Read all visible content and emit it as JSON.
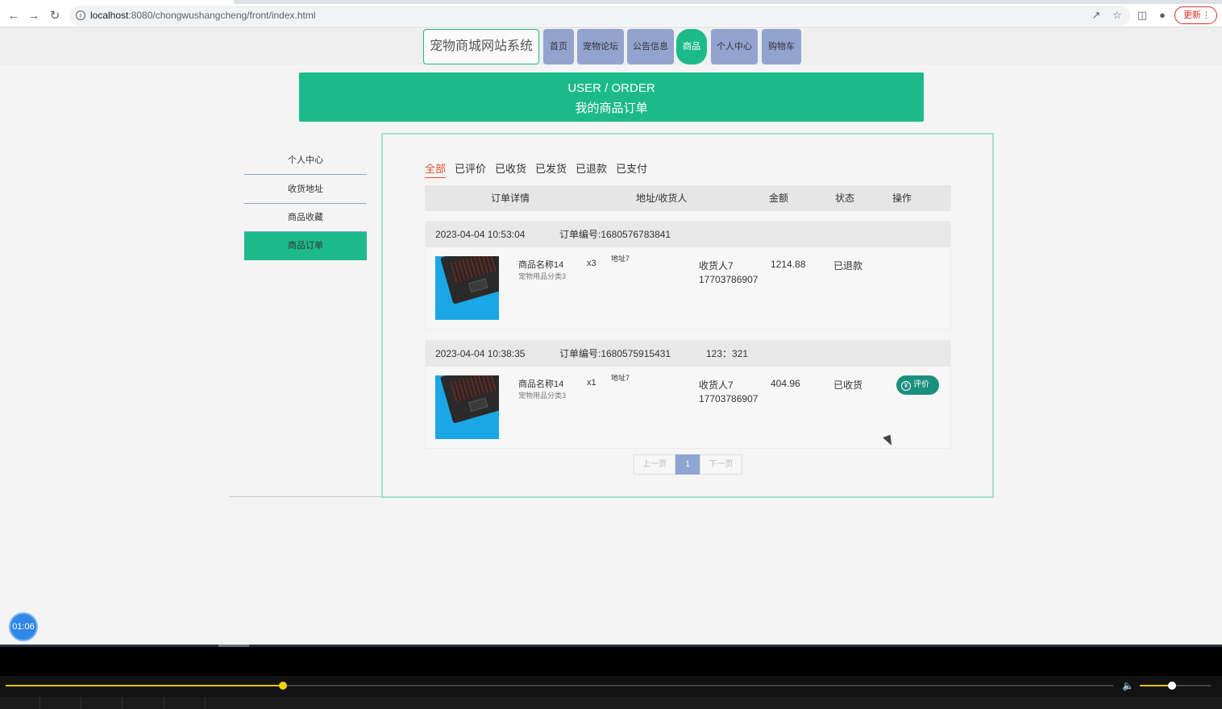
{
  "browser": {
    "url_host": "localhost",
    "url_path": ":8080/chongwushangcheng/front/index.html",
    "update_label": "更新",
    "info_icon": "info-icon",
    "icons": [
      "back-icon",
      "forward-icon",
      "reload-icon",
      "share-icon",
      "star-icon",
      "sidebar-icon",
      "profile-icon"
    ]
  },
  "header": {
    "logo": "宠物商城网站系统",
    "nav": [
      {
        "label": "首页"
      },
      {
        "label": "宠物论坛"
      },
      {
        "label": "公告信息"
      },
      {
        "label": "商品"
      },
      {
        "label": "个人中心"
      },
      {
        "label": "购物车"
      }
    ],
    "active_nav": "商品",
    "accent_color": "#1cba8a",
    "nav_color": "#93a3cf"
  },
  "banner": {
    "en": "USER / ORDER",
    "cn": "我的商品订单"
  },
  "sidebar": {
    "items": [
      {
        "label": "个人中心"
      },
      {
        "label": "收货地址"
      },
      {
        "label": "商品收藏"
      },
      {
        "label": "商品订单"
      }
    ],
    "active": "商品订单"
  },
  "orders": {
    "tabs": [
      {
        "label": "全部"
      },
      {
        "label": "已评价"
      },
      {
        "label": "已收货"
      },
      {
        "label": "已发货"
      },
      {
        "label": "已退款"
      },
      {
        "label": "已支付"
      }
    ],
    "active_tab": "全部",
    "columns": {
      "detail": "订单详情",
      "address": "地址/收货人",
      "amount": "金额",
      "status": "状态",
      "action": "操作"
    },
    "list": [
      {
        "time": "2023-04-04 10:53:04",
        "order_no": "订单编号:1680576783841",
        "note": "",
        "product_name": "商品名称14",
        "product_category": "宠物用品分类3",
        "qty": "x3",
        "address": "地址7",
        "receiver": "收货人7",
        "phone": "17703786907",
        "amount": "1214.88",
        "status": "已退款",
        "action": ""
      },
      {
        "time": "2023-04-04 10:38:35",
        "order_no": "订单编号:1680575915431",
        "note": "123：321",
        "product_name": "商品名称14",
        "product_category": "宠物用品分类3",
        "qty": "x1",
        "address": "地址7",
        "receiver": "收货人7",
        "phone": "17703786907",
        "amount": "404.96",
        "status": "已收货",
        "action": "评价"
      }
    ],
    "pager": {
      "prev": "上一页",
      "current": "1",
      "next": "下一页"
    }
  },
  "overlay": {
    "timer": "01:06"
  },
  "player": {
    "progress": 0.25,
    "volume": 0.45
  }
}
